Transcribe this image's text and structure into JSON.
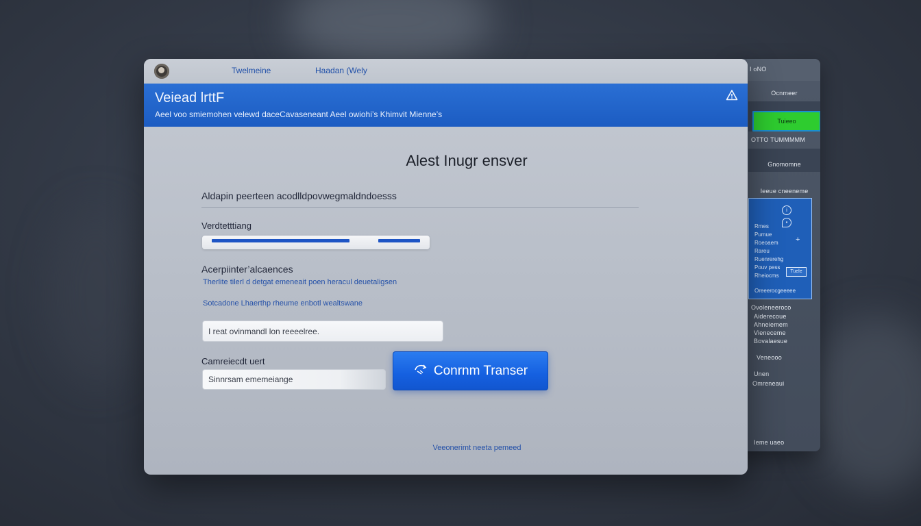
{
  "titlebar": {
    "logo_icon": "app-logo-icon",
    "tabs": [
      {
        "label": "Twelmeine"
      },
      {
        "label": "Haadan (Wely"
      }
    ]
  },
  "banner": {
    "title": "Veiead lrttF",
    "subtitle": "Aeel voo smiemohen velewd daceCavaseneant Aeel owiohi’s Khimvit Mienne’s",
    "alert_icon": "warning-triangle-icon"
  },
  "main": {
    "heading": "Alest Inugr ensver",
    "section_label": "Aldapin peerteen acodlldpovwegmaldndoesss",
    "progress_label": "Verdtetttiang",
    "progress_segments": [
      {
        "start": 0.0,
        "end": 0.66
      },
      {
        "start": 0.8,
        "end": 1.0
      }
    ],
    "acceptance_label": "Acerpiinter’alcaences",
    "acceptance_note": "Therlite tilerl d detgat emeneait poen heracul deuetaligsen",
    "secondary_note": "Sotcadone Lhaerthp rheume enbotl wealtswane",
    "input_amount_placeholder": "I reat ovinmandl lon reeeelree.",
    "reference_label": "Camreiecdt uert",
    "input_reference_placeholder": "Sinnrsam ememeiange",
    "confirm_button_label": "Conrnm Transer",
    "confirm_icon": "transfer-arrows-icon",
    "footer_link": "Veeonerimt neeta pemeed"
  },
  "side_panel": {
    "header": "I oNO",
    "item_1": "Ocnmeer",
    "highlight_item": "Tuieeo",
    "item_3": "OTTO TUMMMMM",
    "item_4": "Gnomomne",
    "item_5": "Ieeue cneeneme",
    "card_lines": [
      "Rmes",
      "Pumue",
      "Roeoaem",
      "Rareu",
      "Ruenrerehg",
      "Pouv pess",
      "Rheiocms"
    ],
    "card_tag": "Tuele",
    "card_footer": "Oreeerocgeeeee",
    "list_items": [
      "Ovoleneeroco",
      "Aiderecoue",
      "Ahneiemem",
      "Vieneceme",
      "Bovalaesue",
      "Veneooo"
    ],
    "extra_1": "Unen",
    "extra_2": "Omreneaui",
    "bottom": "Ieme uaeo"
  }
}
